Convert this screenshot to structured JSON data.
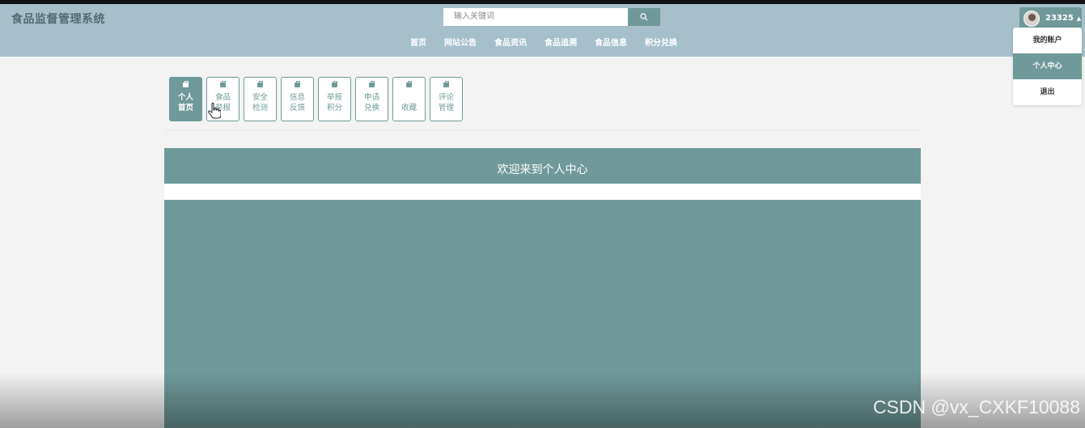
{
  "app": {
    "title": "食品监督管理系统"
  },
  "search": {
    "placeholder": "输入关键词",
    "icon": "search-icon"
  },
  "nav": {
    "items": [
      "首页",
      "网站公告",
      "食品资讯",
      "食品追溯",
      "食品信息",
      "积分兑换"
    ]
  },
  "user": {
    "name": "23325",
    "menu": [
      "我的账户",
      "个人中心",
      "退出"
    ],
    "active_menu": "个人中心"
  },
  "tabs": [
    {
      "label": "个人首页",
      "line1": "个人",
      "line2": "首页",
      "active": true
    },
    {
      "label": "食品举报",
      "line1": "食品",
      "line2": "举报",
      "active": false
    },
    {
      "label": "安全检测",
      "line1": "安全",
      "line2": "检测",
      "active": false
    },
    {
      "label": "信息反馈",
      "line1": "信息",
      "line2": "反馈",
      "active": false
    },
    {
      "label": "举报积分",
      "line1": "举报",
      "line2": "积分",
      "active": false
    },
    {
      "label": "申请兑换",
      "line1": "申请",
      "line2": "兑换",
      "active": false
    },
    {
      "label": "收藏",
      "line1": "收藏",
      "line2": "",
      "active": false
    },
    {
      "label": "评论管理",
      "line1": "评论",
      "line2": "管理",
      "active": false
    }
  ],
  "panel": {
    "title": "欢迎来到个人中心"
  },
  "watermark": "CSDN @vx_CXKF10088",
  "colors": {
    "header": "#a5c0cb",
    "accent": "#6f9a99",
    "background": "#f2f3f2"
  }
}
